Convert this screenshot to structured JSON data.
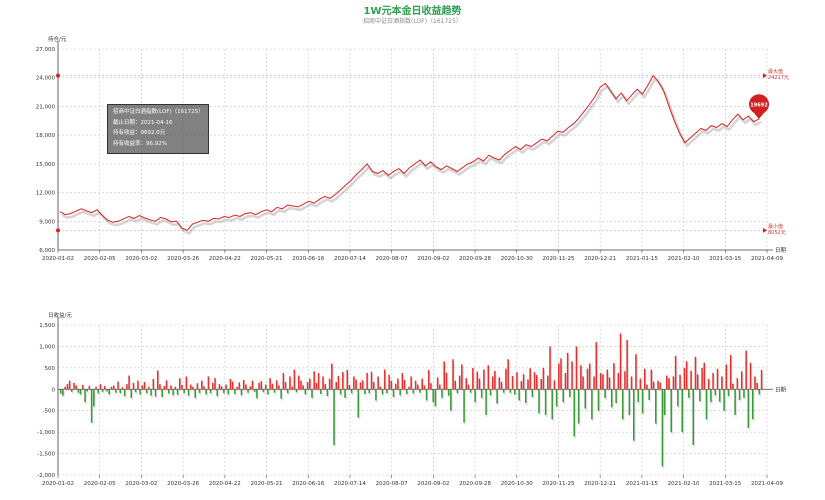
{
  "title": "1W元本金日收益趋势",
  "subtitle": "招商中证白酒指数(LOF)（161725）",
  "colors": {
    "line": "#e02020",
    "up": "#e63030",
    "down": "#3a9a3a",
    "title": "#2e9e4f"
  },
  "tooltip": {
    "fund": "招商中证白酒指数(LOF)（161725）",
    "date": "截止日期：2021-04-16",
    "earning": "持有收益：9692.0元",
    "rate": "持有收益率：96.92%"
  },
  "chart_data": [
    {
      "type": "line",
      "ylabel": "持仓/元",
      "xlabel": "日期",
      "ylim": [
        6000,
        27000
      ],
      "y_ticks": [
        "6,000",
        "9,000",
        "12,000",
        "15,000",
        "18,000",
        "21,000",
        "24,000",
        "27,000"
      ],
      "x_ticks": [
        "2020-01-02",
        "2020-02-05",
        "2020-03-02",
        "2020-03-26",
        "2020-04-22",
        "2020-05-21",
        "2020-06-16",
        "2020-07-14",
        "2020-08-07",
        "2020-09-02",
        "2020-09-28",
        "2020-10-30",
        "2020-11-25",
        "2020-12-21",
        "2021-01-15",
        "2021-02-10",
        "2021-03-15",
        "2021-04-09"
      ],
      "max_label": [
        "最大值",
        "24217元"
      ],
      "min_label": [
        "最小值",
        "8052元"
      ],
      "max_value": 24217,
      "min_value": 8052,
      "last_value": 19692,
      "last_label": "19692",
      "series_values": [
        10000,
        9700,
        9800,
        10050,
        10300,
        10100,
        9900,
        10200,
        9600,
        9100,
        8900,
        9000,
        9250,
        9500,
        9300,
        9600,
        9350,
        9150,
        9000,
        9400,
        9250,
        8950,
        9000,
        8300,
        8052,
        8700,
        8900,
        9100,
        9000,
        9300,
        9250,
        9500,
        9400,
        9650,
        9500,
        9800,
        9900,
        9700,
        10000,
        10200,
        10000,
        10450,
        10300,
        10700,
        10600,
        10500,
        10800,
        11100,
        10900,
        11300,
        11600,
        11400,
        11800,
        12300,
        12800,
        13300,
        13900,
        14400,
        15000,
        14200,
        14000,
        14300,
        13800,
        14200,
        14500,
        14000,
        14600,
        15000,
        15400,
        14800,
        15200,
        14700,
        14400,
        14800,
        14500,
        14200,
        14600,
        15000,
        15200,
        15600,
        15300,
        15900,
        15600,
        15400,
        16000,
        16400,
        16800,
        16500,
        17000,
        16800,
        17200,
        17600,
        17400,
        17900,
        18400,
        18300,
        18800,
        19200,
        19800,
        20500,
        21200,
        22000,
        23000,
        23400,
        22600,
        21800,
        22400,
        21600,
        22200,
        22800,
        22300,
        23200,
        24217,
        23600,
        22600,
        21000,
        19500,
        18200,
        17200,
        17700,
        18200,
        18700,
        18500,
        19000,
        18800,
        19200,
        18900,
        19600,
        20200,
        19600,
        20000,
        19400,
        19692
      ]
    },
    {
      "type": "bar",
      "ylabel": "日收益/元",
      "xlabel": "日期",
      "ylim": [
        -2000,
        1500
      ],
      "y_ticks": [
        "-2,000",
        "-1,500",
        "-1,000",
        "-500",
        "0",
        "500",
        "1,000",
        "1,500"
      ],
      "x_ticks": [
        "2020-01-02",
        "2020-02-05",
        "2020-03-02",
        "2020-03-26",
        "2020-04-22",
        "2020-05-21",
        "2020-06-16",
        "2020-07-14",
        "2020-08-07",
        "2020-09-02",
        "2020-09-28",
        "2020-10-30",
        "2020-11-25",
        "2020-12-21",
        "2021-01-15",
        "2021-02-10",
        "2021-03-15",
        "2021-04-09"
      ],
      "values": [
        -100,
        -150,
        60,
        120,
        200,
        -60,
        150,
        90,
        -80,
        -120,
        100,
        -300,
        -50,
        80,
        -780,
        -400,
        60,
        -90,
        120,
        -60,
        80,
        -50,
        -120,
        60,
        90,
        -80,
        180,
        -90,
        50,
        -160,
        120,
        320,
        -200,
        150,
        -70,
        200,
        -120,
        90,
        170,
        -90,
        60,
        -150,
        240,
        -170,
        440,
        120,
        -180,
        80,
        210,
        -100,
        90,
        -140,
        60,
        -130,
        260,
        100,
        -90,
        300,
        -150,
        110,
        60,
        -200,
        140,
        -90,
        200,
        70,
        -120,
        300,
        -90,
        150,
        260,
        -160,
        120,
        70,
        -90,
        110,
        -120,
        240,
        180,
        -110,
        60,
        160,
        -140,
        220,
        110,
        -80,
        70,
        200,
        -60,
        -210,
        150,
        190,
        -70,
        110,
        -120,
        260,
        130,
        -80,
        210,
        90,
        -220,
        380,
        170,
        -90,
        300,
        60,
        460,
        -70,
        320,
        200,
        90,
        -120,
        170,
        250,
        -200,
        420,
        150,
        380,
        -110,
        300,
        120,
        -160,
        250,
        600,
        -1300,
        170,
        310,
        -120,
        400,
        -200,
        450,
        100,
        -90,
        300,
        230,
        -660,
        160,
        210,
        -110,
        380,
        -90,
        410,
        170,
        -260,
        300,
        60,
        -120,
        460,
        -90,
        340,
        200,
        -180,
        130,
        250,
        -140,
        380,
        220,
        -110,
        60,
        300,
        -100,
        200,
        110,
        -80,
        250,
        90,
        -260,
        450,
        140,
        -300,
        -400,
        280,
        110,
        -200,
        650,
        390,
        -150,
        -500,
        700,
        200,
        -90,
        320,
        580,
        -780,
        260,
        110,
        -80,
        500,
        -300,
        410,
        250,
        -200,
        460,
        -600,
        560,
        -140,
        300,
        430,
        -330,
        280,
        170,
        -80,
        480,
        700,
        -80,
        310,
        -120,
        400,
        -260,
        190,
        350,
        -320,
        230,
        490,
        -180,
        400,
        330,
        -560,
        240,
        500,
        -600,
        320,
        1000,
        -700,
        210,
        -400,
        600,
        720,
        -300,
        380,
        850,
        -180,
        650,
        -1100,
        1000,
        -800,
        560,
        300,
        -450,
        480,
        600,
        -700,
        300,
        1100,
        -500,
        380,
        350,
        -200,
        460,
        280,
        -420,
        610,
        -320,
        380,
        1300,
        -700,
        420,
        1150,
        -600,
        300,
        -1200,
        820,
        -300,
        250,
        -560,
        480,
        110,
        -250,
        460,
        180,
        -800,
        200,
        160,
        -1800,
        -600,
        320,
        260,
        -1000,
        300,
        780,
        -400,
        340,
        -1000,
        500,
        650,
        -200,
        430,
        -1300,
        760,
        350,
        -280,
        500,
        620,
        -700,
        240,
        -300,
        380,
        -140,
        480,
        -290,
        300,
        -500,
        580,
        -160,
        800,
        130,
        -600,
        260,
        -250,
        420,
        -200,
        900,
        -900,
        620,
        -700,
        300,
        150,
        -120,
        450
      ]
    }
  ]
}
